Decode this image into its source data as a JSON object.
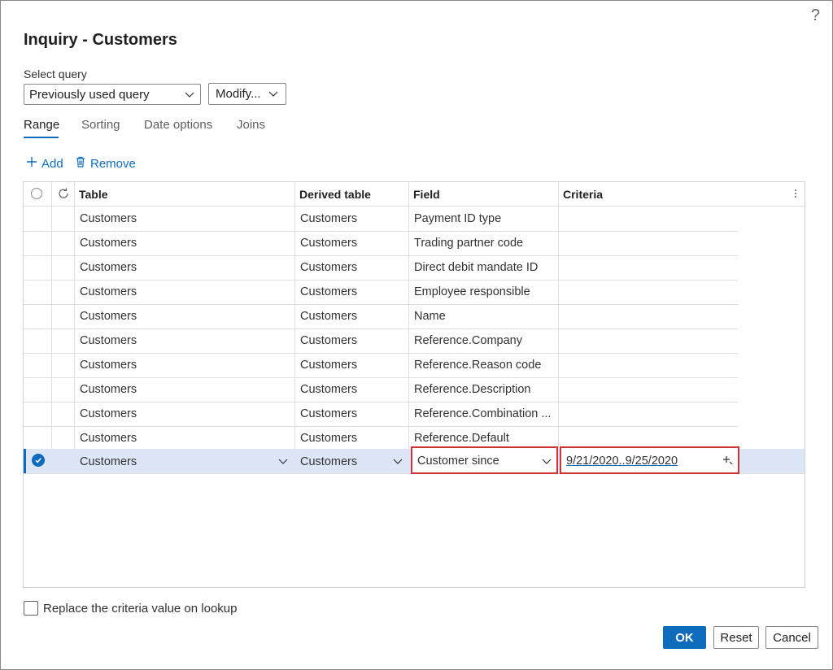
{
  "dialog": {
    "help_glyph": "?",
    "title": "Inquiry - Customers",
    "select_query_label": "Select query",
    "select_query_value": "Previously used query",
    "modify_label": "Modify..."
  },
  "tabs": [
    "Range",
    "Sorting",
    "Date options",
    "Joins"
  ],
  "actions": {
    "add": "Add",
    "remove": "Remove"
  },
  "grid": {
    "columns": [
      "Table",
      "Derived table",
      "Field",
      "Criteria"
    ],
    "rows": [
      {
        "table": "Customers",
        "derived": "Customers",
        "field": "Payment ID type",
        "criteria": ""
      },
      {
        "table": "Customers",
        "derived": "Customers",
        "field": "Trading partner code",
        "criteria": ""
      },
      {
        "table": "Customers",
        "derived": "Customers",
        "field": "Direct debit mandate ID",
        "criteria": ""
      },
      {
        "table": "Customers",
        "derived": "Customers",
        "field": "Employee responsible",
        "criteria": ""
      },
      {
        "table": "Customers",
        "derived": "Customers",
        "field": "Name",
        "criteria": ""
      },
      {
        "table": "Customers",
        "derived": "Customers",
        "field": "Reference.Company",
        "criteria": ""
      },
      {
        "table": "Customers",
        "derived": "Customers",
        "field": "Reference.Reason code",
        "criteria": ""
      },
      {
        "table": "Customers",
        "derived": "Customers",
        "field": "Reference.Description",
        "criteria": ""
      },
      {
        "table": "Customers",
        "derived": "Customers",
        "field": "Reference.Combination ...",
        "criteria": ""
      },
      {
        "table": "Customers",
        "derived": "Customers",
        "field": "Reference.Default",
        "criteria": ""
      }
    ],
    "selected_row": {
      "table": "Customers",
      "derived": "Customers",
      "field": "Customer since",
      "criteria": "9/21/2020..9/25/2020"
    }
  },
  "options": {
    "replace_criteria_label": "Replace the criteria value on lookup",
    "replace_criteria_checked": false
  },
  "buttons": {
    "ok": "OK",
    "reset": "Reset",
    "cancel": "Cancel"
  },
  "colors": {
    "accent": "#0f6cbd",
    "highlight_border": "#d13438",
    "selected_row": "#dde6f7"
  },
  "icons": [
    "help-icon",
    "chevron-down-icon",
    "add-icon",
    "trash-icon",
    "refresh-icon",
    "checkmark-icon",
    "more-icon",
    "lookup-icon"
  ]
}
